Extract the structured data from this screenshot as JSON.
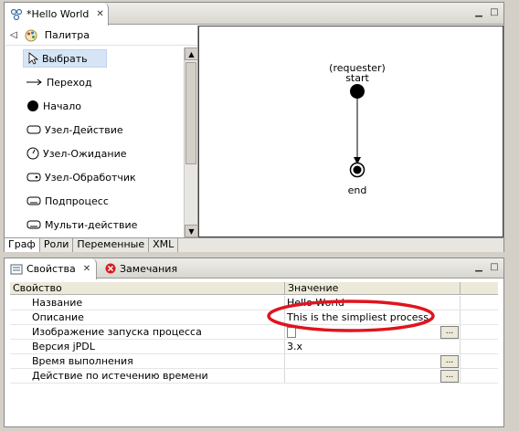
{
  "editor": {
    "tab_title": "*Hello World",
    "palette": {
      "title": "Палитра",
      "items": [
        {
          "label": "Выбрать",
          "icon": "cursor-icon",
          "selected": true
        },
        {
          "label": "Переход",
          "icon": "arrow-icon"
        },
        {
          "label": "Начало",
          "icon": "start-node-icon"
        },
        {
          "label": "Узел-Действие",
          "icon": "action-node-icon"
        },
        {
          "label": "Узел-Ожидание",
          "icon": "wait-node-icon"
        },
        {
          "label": "Узел-Обработчик",
          "icon": "handler-node-icon"
        },
        {
          "label": "Подпроцесс",
          "icon": "subprocess-icon"
        },
        {
          "label": "Мульти-действие",
          "icon": "multiaction-icon"
        }
      ]
    },
    "diagram": {
      "start_label_1": "(requester)",
      "start_label_2": "start",
      "end_label": "end"
    },
    "bottom_tabs": [
      "Граф",
      "Роли",
      "Переменные",
      "XML"
    ]
  },
  "properties": {
    "tabs": {
      "properties": "Свойства",
      "problems": "Замечания"
    },
    "columns": {
      "property": "Свойство",
      "value": "Значение"
    },
    "rows": [
      {
        "name": "Название",
        "value": "Hello World"
      },
      {
        "name": "Описание",
        "value": "This is the simpliest process"
      },
      {
        "name": "Изображение запуска процесса",
        "value": ""
      },
      {
        "name": "Версия jPDL",
        "value": "3.x"
      },
      {
        "name": "Время выполнения",
        "value": ""
      },
      {
        "name": "Действие по истечению времени",
        "value": ""
      }
    ],
    "button_label": "...",
    "annotation_color": "#e0141e"
  }
}
